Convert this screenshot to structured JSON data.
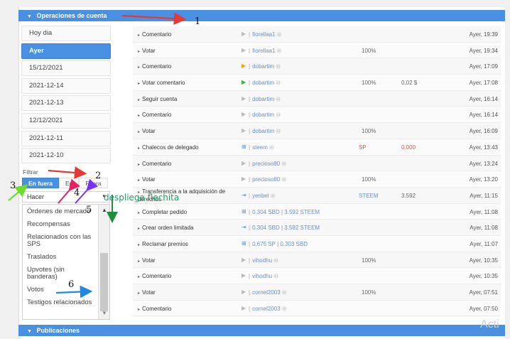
{
  "sections": {
    "operaciones": "Operaciones de cuenta",
    "publicaciones": "Publicaciones"
  },
  "dates": [
    "Hoy dia",
    "Ayer",
    "15/12/2021",
    "2021-12-14",
    "2021-12-13",
    "12/12/2021",
    "2021-12-11",
    "2021-12-10"
  ],
  "filter": {
    "label": "Filtrar",
    "buttons": [
      "En fuera",
      "En",
      "Fuera"
    ]
  },
  "hacer": "Hacer",
  "options": [
    "Órdenes de mercado",
    "Recompensas",
    "Relacionados con las SPS",
    "Traslados",
    "Upvotes (sin banderas)",
    "Votos",
    "Testigos relacionados"
  ],
  "operations": [
    {
      "type": "Comentario",
      "user": "fiorellaa1",
      "pct": "",
      "cur": "",
      "amt": "",
      "time": "Ayer, 19:39"
    },
    {
      "type": "Votar",
      "user": "fiorellaa1",
      "pct": "100%",
      "cur": "",
      "amt": "",
      "time": "Ayer, 19:34"
    },
    {
      "type": "Comentario",
      "user": "dobartim",
      "pct": "",
      "cur": "",
      "amt": "",
      "time": "Ayer, 17:09"
    },
    {
      "type": "Votar comentario",
      "user": "dobartim",
      "pct": "100%",
      "cur": "",
      "amt": "0,02 $",
      "time": "Ayer, 17:08"
    },
    {
      "type": "Seguir cuenta",
      "user": "dobartim",
      "pct": "",
      "cur": "",
      "amt": "",
      "time": "Ayer, 16:14"
    },
    {
      "type": "Comentario",
      "user": "dobartim",
      "pct": "",
      "cur": "",
      "amt": "",
      "time": "Ayer, 16:14"
    },
    {
      "type": "Votar",
      "user": "dobartim",
      "pct": "100%",
      "cur": "",
      "amt": "",
      "time": "Ayer, 16:09"
    },
    {
      "type": "Chalecos de delegado",
      "user": "steem",
      "pct": "",
      "cur": "SP",
      "amt": "0.000",
      "time": "Ayer, 13:43"
    },
    {
      "type": "Comentario",
      "user": "precioso80",
      "pct": "",
      "cur": "",
      "amt": "",
      "time": "Ayer, 13:24"
    },
    {
      "type": "Votar",
      "user": "precioso80",
      "pct": "100%",
      "cur": "",
      "amt": "",
      "time": "Ayer, 13:20"
    },
    {
      "type": "Transferencia a la adquisición de derechos",
      "user": "yenbel",
      "pct": "",
      "cur": "STEEM",
      "amt": "3.592",
      "time": "Ayer, 11:15"
    },
    {
      "type": "Completar pedido",
      "user": "0.304 SBD | 3.592 STEEM",
      "pct": "",
      "cur": "",
      "amt": "",
      "time": "Ayer, 11:08"
    },
    {
      "type": "Crear orden limitada",
      "user": "0.304 SBD | 3.592 STEEM",
      "pct": "",
      "cur": "",
      "amt": "",
      "time": "Ayer, 11:08"
    },
    {
      "type": "Reclamar premios",
      "user": "0,675 SP | 0.303 SBD",
      "pct": "",
      "cur": "",
      "amt": "",
      "time": "Ayer, 11:07"
    },
    {
      "type": "Votar",
      "user": "vihodhu",
      "pct": "100%",
      "cur": "",
      "amt": "",
      "time": "Ayer, 10:35"
    },
    {
      "type": "Comentario",
      "user": "vihodhu",
      "pct": "",
      "cur": "",
      "amt": "",
      "time": "Ayer, 10:35"
    },
    {
      "type": "Votar",
      "user": "cornel2003",
      "pct": "100%",
      "cur": "",
      "amt": "",
      "time": "Ayer, 07:51"
    },
    {
      "type": "Comentario",
      "user": "cornel2003",
      "pct": "",
      "cur": "",
      "amt": "",
      "time": "Ayer, 07:50"
    }
  ],
  "annotations": {
    "n1": "1",
    "n2": "2",
    "n3": "3",
    "n4": "4",
    "n5": "5",
    "n6": "6",
    "note": "despliega flechita"
  },
  "watermark": "Acti",
  "colors": {
    "accent": "#4a90e2",
    "red_arrow": "#e53935",
    "green_arrow": "#1e8e3e",
    "blue_arrow": "#1e88e5",
    "purple_arrow": "#7b2ff7",
    "pink_arrow": "#e91e63",
    "lime_arrow": "#6ddc2d"
  }
}
